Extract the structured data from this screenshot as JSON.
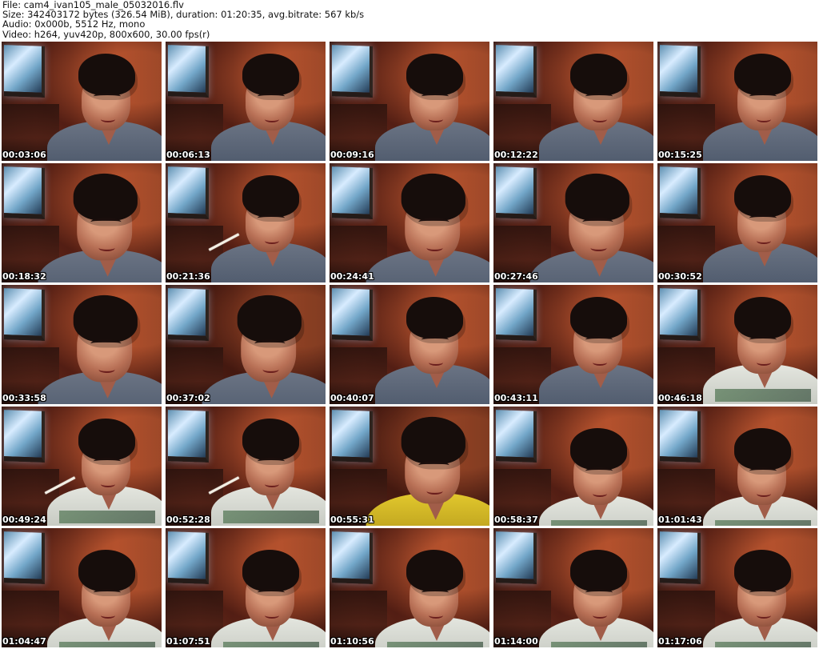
{
  "file_info": {
    "file": "File: cam4_ivan105_male_05032016.flv",
    "size": "Size: 342403172 bytes (326.54 MiB), duration: 01:20:35, avg.bitrate: 567 kb/s",
    "audio": "Audio: 0x000b, 5512 Hz, mono",
    "video": "Video: h264, yuv420p, 800x600, 30.00 fps(r)"
  },
  "thumbnails": [
    {
      "timestamp": "00:03:06",
      "icon": "thumbnail-image",
      "style": "gray"
    },
    {
      "timestamp": "00:06:13",
      "icon": "thumbnail-image",
      "style": "gray"
    },
    {
      "timestamp": "00:09:16",
      "icon": "thumbnail-image",
      "style": "gray"
    },
    {
      "timestamp": "00:12:22",
      "icon": "thumbnail-image",
      "style": "gray"
    },
    {
      "timestamp": "00:15:25",
      "icon": "thumbnail-image",
      "style": "gray"
    },
    {
      "timestamp": "00:18:32",
      "icon": "thumbnail-image",
      "style": "gray close"
    },
    {
      "timestamp": "00:21:36",
      "icon": "thumbnail-image",
      "style": "gray"
    },
    {
      "timestamp": "00:24:41",
      "icon": "thumbnail-image",
      "style": "gray close"
    },
    {
      "timestamp": "00:27:46",
      "icon": "thumbnail-image",
      "style": "gray close"
    },
    {
      "timestamp": "00:30:52",
      "icon": "thumbnail-image",
      "style": "gray"
    },
    {
      "timestamp": "00:33:58",
      "icon": "thumbnail-image",
      "style": "gray close"
    },
    {
      "timestamp": "00:37:02",
      "icon": "thumbnail-image",
      "style": "dark close"
    },
    {
      "timestamp": "00:40:07",
      "icon": "thumbnail-image",
      "style": "gray"
    },
    {
      "timestamp": "00:43:11",
      "icon": "thumbnail-image",
      "style": "gray"
    },
    {
      "timestamp": "00:46:18",
      "icon": "thumbnail-image",
      "style": "white"
    },
    {
      "timestamp": "00:49:24",
      "icon": "thumbnail-image",
      "style": "white"
    },
    {
      "timestamp": "00:52:28",
      "icon": "thumbnail-image",
      "style": "white"
    },
    {
      "timestamp": "00:55:31",
      "icon": "thumbnail-image",
      "style": "yellow dark close"
    },
    {
      "timestamp": "00:58:37",
      "icon": "thumbnail-image",
      "style": "white low"
    },
    {
      "timestamp": "01:01:43",
      "icon": "thumbnail-image",
      "style": "white low"
    },
    {
      "timestamp": "01:04:47",
      "icon": "thumbnail-image",
      "style": "white low"
    },
    {
      "timestamp": "01:07:51",
      "icon": "thumbnail-image",
      "style": "white low"
    },
    {
      "timestamp": "01:10:56",
      "icon": "thumbnail-image",
      "style": "white low"
    },
    {
      "timestamp": "01:14:00",
      "icon": "thumbnail-image",
      "style": "white low"
    },
    {
      "timestamp": "01:17:06",
      "icon": "thumbnail-image",
      "style": "white low"
    }
  ]
}
